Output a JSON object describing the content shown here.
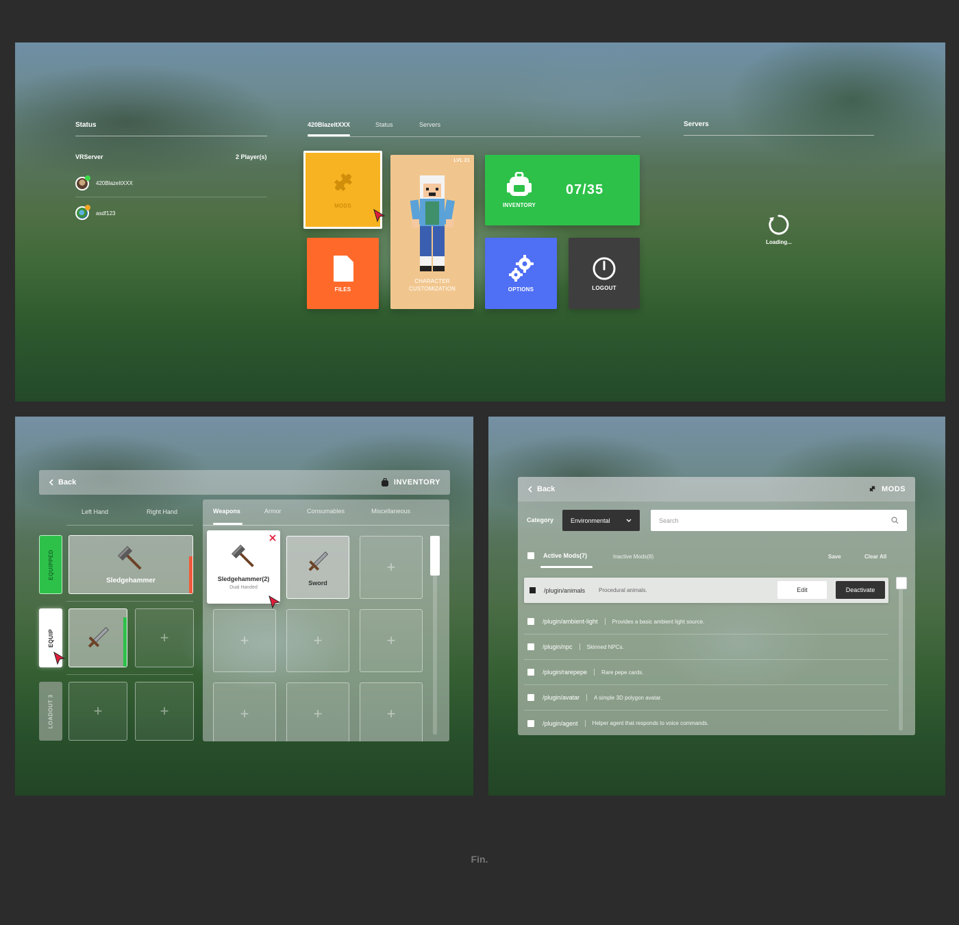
{
  "main_menu": {
    "status_panel": {
      "title": "Status",
      "server_name": "VRServer",
      "player_count": "2 Player(s)",
      "players": [
        {
          "name": "420BlazeItXXX",
          "status_color": "#3ddc4a"
        },
        {
          "name": "asdf123",
          "status_color": "#f5a623"
        }
      ]
    },
    "tabs": [
      {
        "label": "420BlazeItXXX",
        "active": true
      },
      {
        "label": "Status",
        "active": false
      },
      {
        "label": "Servers",
        "active": false
      }
    ],
    "tiles": {
      "mods": {
        "label": "MODS",
        "color": "#f7b321",
        "icon": "puzzle-icon"
      },
      "files": {
        "label": "FILES",
        "color": "#ff6a2b",
        "icon": "file-icon"
      },
      "character": {
        "label": "CHARACTER CUSTOMIZATION",
        "level": "LVL 21",
        "color": "#f1c68e"
      },
      "inventory": {
        "label": "INVENTORY",
        "count": "07/35",
        "color": "#2dc14a",
        "icon": "backpack-icon"
      },
      "options": {
        "label": "OPTIONS",
        "color": "#4f6ff5",
        "icon": "gear-icon"
      },
      "logout": {
        "label": "LOGOUT",
        "color": "#3e3e3e",
        "icon": "power-icon"
      }
    },
    "servers_panel": {
      "title": "Servers",
      "loading_text": "Loading..."
    }
  },
  "inventory": {
    "back_label": "Back",
    "title": "INVENTORY",
    "hand_labels": {
      "left": "Left Hand",
      "right": "Right Hand"
    },
    "loadouts": [
      {
        "label": "EQUIPPED",
        "color": "#2dc14a"
      },
      {
        "label": "EQUIP",
        "color": "#ffffff"
      },
      {
        "label": "LOADOUT 3",
        "color": "#8a9a8a"
      }
    ],
    "equipped_item": {
      "name": "Sledgehammer",
      "icon": "sledgehammer-icon"
    },
    "weapon_tabs": [
      "Weapons",
      "Armor",
      "Consumables",
      "Miscellaneous"
    ],
    "items": [
      {
        "name": "Sledgehammer(2)",
        "sub": "Dual Handed",
        "icon": "sledgehammer-icon",
        "selected": true
      },
      {
        "name": "Sword",
        "icon": "sword-icon"
      }
    ]
  },
  "mods": {
    "back_label": "Back",
    "title": "MODS",
    "category_label": "Category",
    "category_value": "Environmental",
    "search_placeholder": "Search",
    "tabs": {
      "active": "Active Mods(7)",
      "inactive": "Inactive Mods(8)"
    },
    "save_label": "Save",
    "clear_label": "Clear All",
    "edit_label": "Edit",
    "deactivate_label": "Deactivate",
    "rows": [
      {
        "name": "/plugin/animals",
        "desc": "Procedural animals."
      },
      {
        "name": "/plugin/ambient-light",
        "desc": "Provides a basic ambient light source."
      },
      {
        "name": "/plugin/npc",
        "desc": "Skinned NPCs."
      },
      {
        "name": "/plugin/rarepepe",
        "desc": "Rare pepe cards."
      },
      {
        "name": "/plugin/avatar",
        "desc": "A simple 3D polygon avatar."
      },
      {
        "name": "/plugin/agent",
        "desc": "Helper agent that responds to voice commands."
      }
    ]
  },
  "footer": {
    "text": "Fin."
  }
}
